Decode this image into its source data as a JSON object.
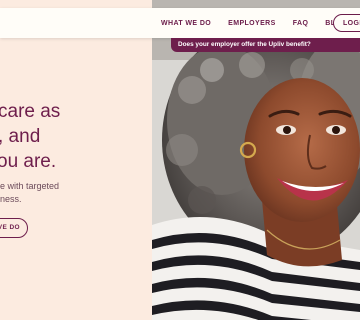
{
  "nav": {
    "links": [
      "WHAT WE DO",
      "EMPLOYERS",
      "FAQ",
      "BLOG"
    ],
    "login_label": "LOGIN"
  },
  "banner": {
    "text": "Does your employer offer the Upliv benefit?"
  },
  "hero": {
    "headline_lines": [
      "care as",
      ", and",
      "ou are."
    ],
    "subtext_lines": [
      "e with targeted",
      "ness."
    ],
    "cta_label": "VE DO"
  },
  "colors": {
    "brand": "#6e1e4c",
    "page_background": "#fcebe0",
    "nav_background": "#fffdf8"
  }
}
